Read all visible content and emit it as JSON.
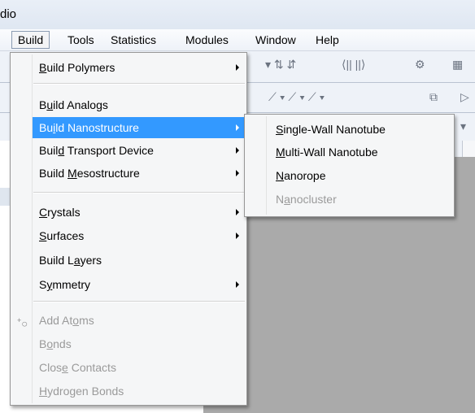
{
  "window": {
    "title": "dio"
  },
  "menubar": {
    "items": [
      {
        "label": "Build",
        "active": true
      },
      {
        "label": "Tools"
      },
      {
        "label": "Statistics"
      },
      {
        "label": "Modules"
      },
      {
        "label": "Window"
      },
      {
        "label": "Help"
      }
    ]
  },
  "build_menu": {
    "items": [
      {
        "pre": "",
        "u": "B",
        "post": "uild Polymers",
        "submenu": true
      },
      {
        "pre": "B",
        "u": "u",
        "post": "ild Analogs"
      },
      {
        "pre": "Bu",
        "u": "i",
        "post": "ld Nanostructure",
        "submenu": true,
        "highlighted": true
      },
      {
        "pre": "Buil",
        "u": "d",
        "post": " Transport Device",
        "submenu": true
      },
      {
        "pre": "Build ",
        "u": "M",
        "post": "esostructure",
        "submenu": true
      },
      {
        "pre": "",
        "u": "C",
        "post": "rystals",
        "submenu": true
      },
      {
        "pre": "",
        "u": "S",
        "post": "urfaces",
        "submenu": true
      },
      {
        "pre": "Build L",
        "u": "a",
        "post": "yers"
      },
      {
        "pre": "S",
        "u": "y",
        "post": "mmetry",
        "submenu": true
      },
      {
        "pre": "Add At",
        "u": "o",
        "post": "ms",
        "disabled": true,
        "icon": "add-atoms-icon"
      },
      {
        "pre": "B",
        "u": "o",
        "post": "nds",
        "disabled": true
      },
      {
        "pre": "Clos",
        "u": "e",
        "post": " Contacts",
        "disabled": true
      },
      {
        "pre": "",
        "u": "H",
        "post": "ydrogen Bonds",
        "disabled": true
      }
    ]
  },
  "nano_submenu": {
    "items": [
      {
        "pre": "",
        "u": "S",
        "post": "ingle-Wall Nanotube"
      },
      {
        "pre": "",
        "u": "M",
        "post": "ulti-Wall Nanotube"
      },
      {
        "pre": "",
        "u": "N",
        "post": "anorope"
      },
      {
        "pre": "N",
        "u": "a",
        "post": "nocluster",
        "disabled": true
      }
    ]
  },
  "icons": {
    "add_atoms": "add-atoms-icon",
    "submenu_arrow": "submenu-arrow-icon"
  },
  "colors": {
    "highlight": "#3399ff",
    "menu_bg": "#f5f6f7",
    "workspace": "#aaaaaa",
    "disabled_text": "#9a9a9a"
  }
}
